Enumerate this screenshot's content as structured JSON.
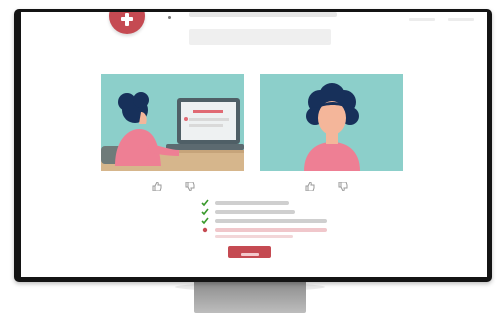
{
  "theme": {
    "accent": "#c54a52",
    "panel_bg": "#8ccfca",
    "check_color": "#3a9a2c",
    "bezel": "#141414"
  },
  "header": {
    "logo_icon": "plus-badge-icon"
  },
  "media": {
    "left_panel": {
      "illustration": "person-at-laptop-illustration"
    },
    "right_panel": {
      "illustration": "person-portrait-illustration"
    },
    "left_controls": [
      "thumbs-up-icon",
      "thumbs-down-icon"
    ],
    "right_controls": [
      "thumbs-up-icon",
      "thumbs-down-icon"
    ]
  },
  "checklist": {
    "items": [
      {
        "state": "checked"
      },
      {
        "state": "checked"
      },
      {
        "state": "checked"
      },
      {
        "state": "warning"
      }
    ]
  },
  "cta": {
    "label": ""
  }
}
